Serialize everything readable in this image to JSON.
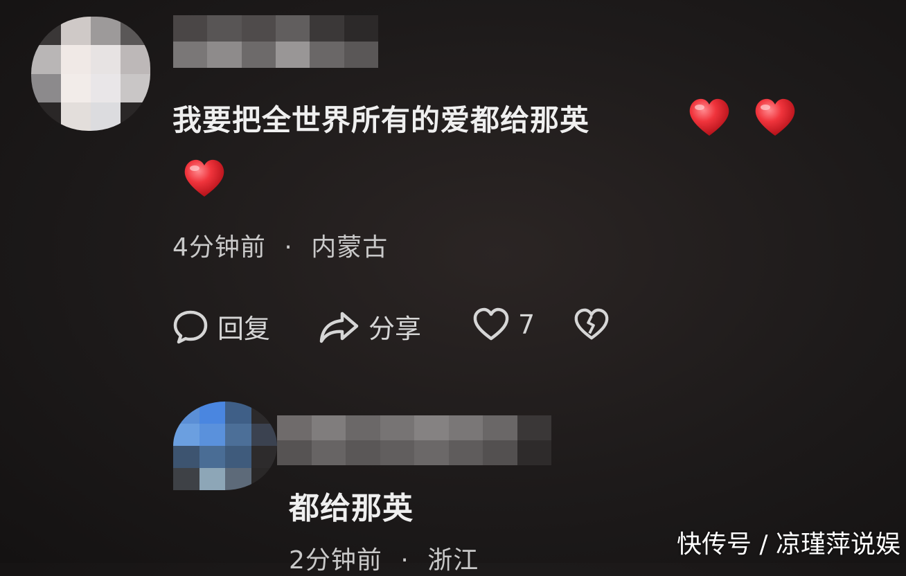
{
  "comment": {
    "text": "我要把全世界所有的爱都给那英",
    "time": "4分钟前",
    "separator": "·",
    "location": "内蒙古",
    "hearts_count": 3
  },
  "actions": {
    "reply_label": "回复",
    "share_label": "分享",
    "like_count": "7"
  },
  "reply": {
    "text": "都给那英",
    "time": "2分钟前",
    "separator": "·",
    "location": "浙江"
  },
  "watermark": "快传号 / 凉瑾萍说娱",
  "colors": {
    "heart": "#e8262f",
    "text": "#efefef",
    "meta": "#c9c9c9",
    "background": "#1d1a1a"
  },
  "icons": [
    "comment-bubble-icon",
    "share-arrow-icon",
    "heart-outline-icon",
    "broken-heart-icon",
    "red-heart-emoji"
  ]
}
